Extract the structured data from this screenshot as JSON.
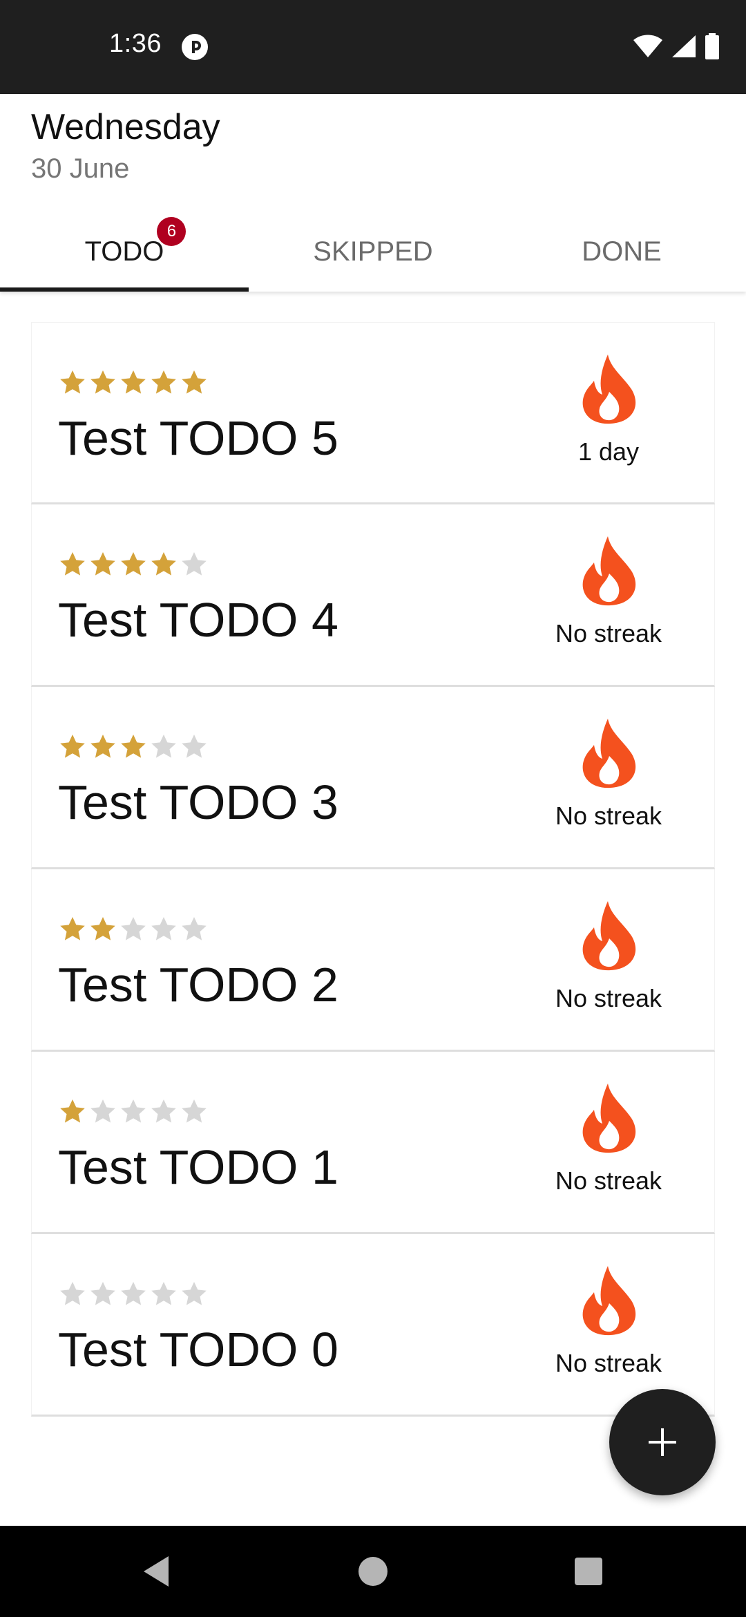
{
  "status_bar": {
    "time": "1:36",
    "app_icon": "pocket-casts-icon",
    "icons": [
      "wifi-icon",
      "signal-icon",
      "battery-icon"
    ]
  },
  "header": {
    "day": "Wednesday",
    "date": "30 June"
  },
  "tabs": [
    {
      "label": "TODO",
      "badge": "6",
      "active": true
    },
    {
      "label": "SKIPPED",
      "active": false
    },
    {
      "label": "DONE",
      "active": false
    }
  ],
  "colors": {
    "star_filled": "#D4A23A",
    "star_empty": "#D6D6D6",
    "fire": "#F4511E",
    "badge": "#B00020",
    "fab": "#1F1F1F"
  },
  "todos": [
    {
      "title": "Test TODO 5",
      "rating": 5,
      "streak": "1 day"
    },
    {
      "title": "Test TODO 4",
      "rating": 4,
      "streak": "No streak"
    },
    {
      "title": "Test TODO 3",
      "rating": 3,
      "streak": "No streak"
    },
    {
      "title": "Test TODO 2",
      "rating": 2,
      "streak": "No streak"
    },
    {
      "title": "Test TODO 1",
      "rating": 1,
      "streak": "No streak"
    },
    {
      "title": "Test TODO 0",
      "rating": 0,
      "streak": "No streak"
    }
  ],
  "fab": {
    "icon": "plus-icon"
  },
  "nav": {
    "icons": [
      "back-icon",
      "home-icon",
      "recents-icon"
    ]
  }
}
